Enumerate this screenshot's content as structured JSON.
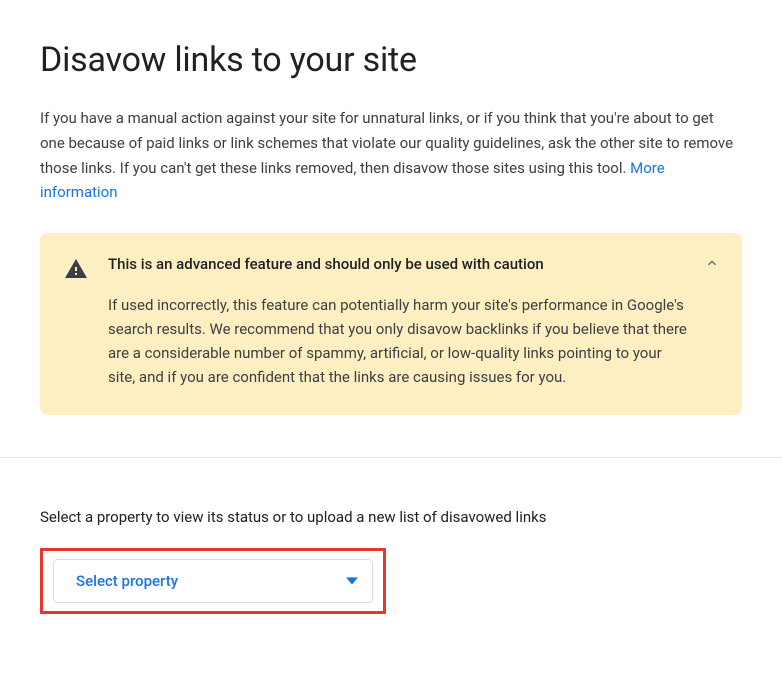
{
  "page": {
    "title": "Disavow links to your site",
    "intro": "If you have a manual action against your site for unnatural links, or if you think that you're about to get one because of paid links or link schemes that violate our quality guidelines, ask the other site to remove those links. If you can't get these links removed, then disavow those sites using this tool. ",
    "more_info_label": "More information"
  },
  "warning": {
    "title": "This is an advanced feature and should only be used with caution",
    "body": "If used incorrectly, this feature can potentially harm your site's performance in Google's search results. We recommend that you only disavow backlinks if you believe that there are a considerable number of spammy, artificial, or low-quality links pointing to your site, and if you are confident that the links are causing issues for you.",
    "icon": "warning-triangle-icon",
    "collapse_icon": "chevron-up-icon"
  },
  "property_section": {
    "label": "Select a property to view its status or to upload a new list of disavowed links",
    "select_placeholder": "Select property",
    "dropdown_icon": "caret-down-icon"
  },
  "colors": {
    "link": "#1a73e8",
    "warning_bg": "#feefc3",
    "highlight_border": "#e8352d"
  }
}
